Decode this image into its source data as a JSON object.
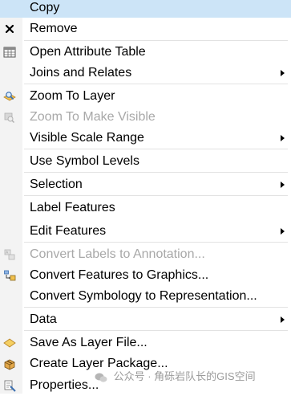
{
  "menu": {
    "copy": "Copy",
    "remove": "Remove",
    "open_attribute_table": "Open Attribute Table",
    "joins_and_relates": "Joins and Relates",
    "zoom_to_layer": "Zoom To Layer",
    "zoom_to_make_visible": "Zoom To Make Visible",
    "visible_scale_range": "Visible Scale Range",
    "use_symbol_levels": "Use Symbol Levels",
    "selection": "Selection",
    "label_features": "Label Features",
    "edit_features": "Edit Features",
    "convert_labels_to_annotation": "Convert Labels to Annotation...",
    "convert_features_to_graphics": "Convert Features to Graphics...",
    "convert_symbology_to_representation": "Convert Symbology to Representation...",
    "data": "Data",
    "save_as_layer_file": "Save As Layer File...",
    "create_layer_package": "Create Layer Package...",
    "properties": "Properties..."
  },
  "watermark": "公众号 · 角砾岩队长的GIS空间",
  "colors": {
    "highlight": "#cce4f7",
    "disabled_text": "#a8a8a8",
    "icon_gutter": "#f3f3f3"
  }
}
